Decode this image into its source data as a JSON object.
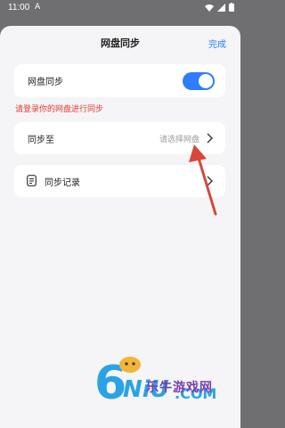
{
  "status_bar": {
    "time": "11:00",
    "notif": "A"
  },
  "header": {
    "title": "网盘同步",
    "done_label": "完成"
  },
  "sync_card": {
    "label": "网盘同步",
    "toggle_on": true
  },
  "warning": "请登录你的网盘进行同步",
  "target_card": {
    "label": "同步至",
    "placeholder": "请选择网盘"
  },
  "record_card": {
    "label": "同步记录"
  },
  "watermark": {
    "text": "乐牛游戏网",
    "domain": ".COM",
    "digit": "6"
  },
  "colors": {
    "accent": "#2f7dff",
    "warning": "#e53935",
    "arrow": "#d9463a"
  }
}
